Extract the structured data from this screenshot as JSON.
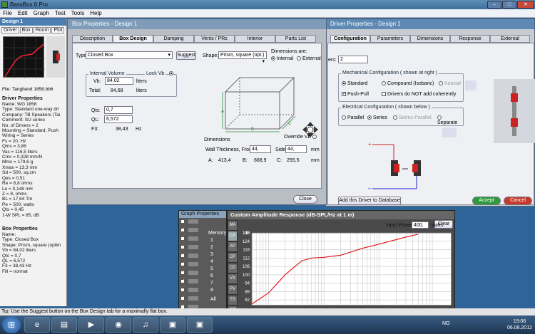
{
  "app": {
    "title": "BassBox 6 Pro"
  },
  "menu": [
    "File",
    "Edit",
    "Graph",
    "Test",
    "Tools",
    "Help"
  ],
  "design_panel": {
    "title": "Design 1",
    "tabs": [
      "Driver",
      "Box",
      "Room",
      "Plot"
    ],
    "file": "File: Tangband 1858.bb6",
    "driver_title": "Driver Properties",
    "driver_lines": "Name: WG 1858\nType: Standard one-way dri\nCompany: TB Speakers (Tai\nComment: SU series\nNo. of Drivers = 2\nMounting = Standard, Push\nWiring = Series\nFs = 20, Hz\nQms = 3,88\nVas = 116,5 liters\nCms = 0,328 mm/N\nMms = 179,6 g\nXmax = 13,3 mm\nSd = 500, sq.cm\nQes = 0,51\nRe = 6,8 ohms\nLe = 0,148 mH\nZ = 8, ohms\nBL = 17,64 Tm\nPe = 500, watts\nQts = 0,45\n1-W SPL = 85, dB",
    "box_title": "Box Properties",
    "box_lines": "Name:\nType: Closed Box\nShape: Prism, square (optim\nVb = 84,02 liters\nQtc = 0,7\nQL = 6,572\nF3 = 38,43 Hz\nFill = normal"
  },
  "driver_window": {
    "title": "Driver Properties - Design 1",
    "tabs": [
      "Configuration",
      "Parameters",
      "Dimensions",
      "Response",
      "External"
    ],
    "drivers_label": "ers:",
    "drivers_value": "2",
    "mech_title": "Mechanical Configuration  ( shown at right )",
    "mech_opts": [
      "Standard",
      "Compound (Isobaric)",
      "Koaxial"
    ],
    "pushpull": "Push-Pull",
    "not_coherent": "Drivers do NOT add coherently",
    "elec_title": "Electrical Configuration  ( shown below )",
    "elec_opts": [
      "Parallel",
      "Series",
      "Series-Parallel",
      "Separate"
    ],
    "add_db": "Add this Driver to Database",
    "accept": "Accept",
    "cancel": "Cancel"
  },
  "box_window": {
    "title": "Box Properties - Design 1",
    "tabs": [
      "Description",
      "Box Design",
      "Damping",
      "Vents / PRs",
      "Interior",
      "Parts List"
    ],
    "type_label": "Type",
    "type_value": "Closed Box",
    "suggest": "Suggest",
    "shape_label": "Shape:",
    "shape_value": "Prism, square (opt.)",
    "dims_are": "Dimensions are:",
    "internal": "Internal",
    "external": "External",
    "vol_title": "Internal Volume",
    "lock": "Lock Vb",
    "vb_label": "Vb:",
    "vb_value": "84,02",
    "vb_unit": "liters",
    "total_label": "Total:",
    "total_value": "84,68",
    "total_unit": "liters",
    "qtc_label": "Qtc:",
    "qtc_value": "0,7",
    "ql_label": "QL:",
    "ql_value": "6,572",
    "f3_label": "F3:",
    "f3_value": "38,43",
    "f3_unit": "Hz",
    "dims_title": "Dimensions",
    "override": "Override Vb",
    "wall_label": "Wall Thickness, Front:",
    "wall_value": "44,",
    "side_label": "Side:",
    "side_value": "44,",
    "mm": "mm",
    "a_label": "A:",
    "a_value": "413,4",
    "b_label": "B:",
    "b_value": "668,9",
    "c_label": "C:",
    "c_value": "255,5",
    "close": "Close",
    "box_letters": [
      "A",
      "B",
      "C"
    ]
  },
  "graph_props": {
    "title": "Graph Properties",
    "memory": "Memory",
    "clear": "Clear",
    "all": "All",
    "nums": [
      "1",
      "2",
      "3",
      "4",
      "5",
      "6",
      "7",
      "8"
    ]
  },
  "graph": {
    "title": "Custom Amplitude Response (dB-SPL/Hz at 1 m)",
    "input_label": "Input Power:",
    "input_value": "400,",
    "input_unit": "watts",
    "side_tabs": [
      "MA",
      "CA",
      "AP",
      "CP",
      "CD",
      "VX",
      "PV",
      "TS",
      "PT",
      "GD"
    ]
  },
  "chart_data": {
    "type": "line",
    "title": "Custom Amplitude Response (dB-SPL/Hz at 1 m)",
    "xlabel": "",
    "ylabel": "dB",
    "x_scale": "log",
    "xlim": [
      5,
      20000
    ],
    "ylim": [
      78,
      130
    ],
    "x_ticks": [
      "5 Hz",
      "10",
      "50",
      "100",
      "500",
      "1 K",
      "5 K",
      "10 K",
      "20 K"
    ],
    "y_ticks": [
      "130",
      "124",
      "118",
      "112",
      "106",
      "100",
      "94",
      "88",
      "82"
    ],
    "series": [
      {
        "values": [
          [
            5,
            79
          ],
          [
            10,
            87
          ],
          [
            20,
            100
          ],
          [
            30,
            106
          ],
          [
            40,
            110
          ],
          [
            60,
            112
          ],
          [
            100,
            112.5
          ],
          [
            200,
            114
          ],
          [
            500,
            119
          ],
          [
            1000,
            122
          ],
          [
            3000,
            127
          ],
          [
            5000,
            129
          ]
        ]
      }
    ]
  },
  "status": "Tip: Use the Suggest button on the Box Design tab for a maximally flat box.",
  "taskbar": {
    "lang": "NO",
    "time": "19:06",
    "date": "06.08.2012"
  }
}
